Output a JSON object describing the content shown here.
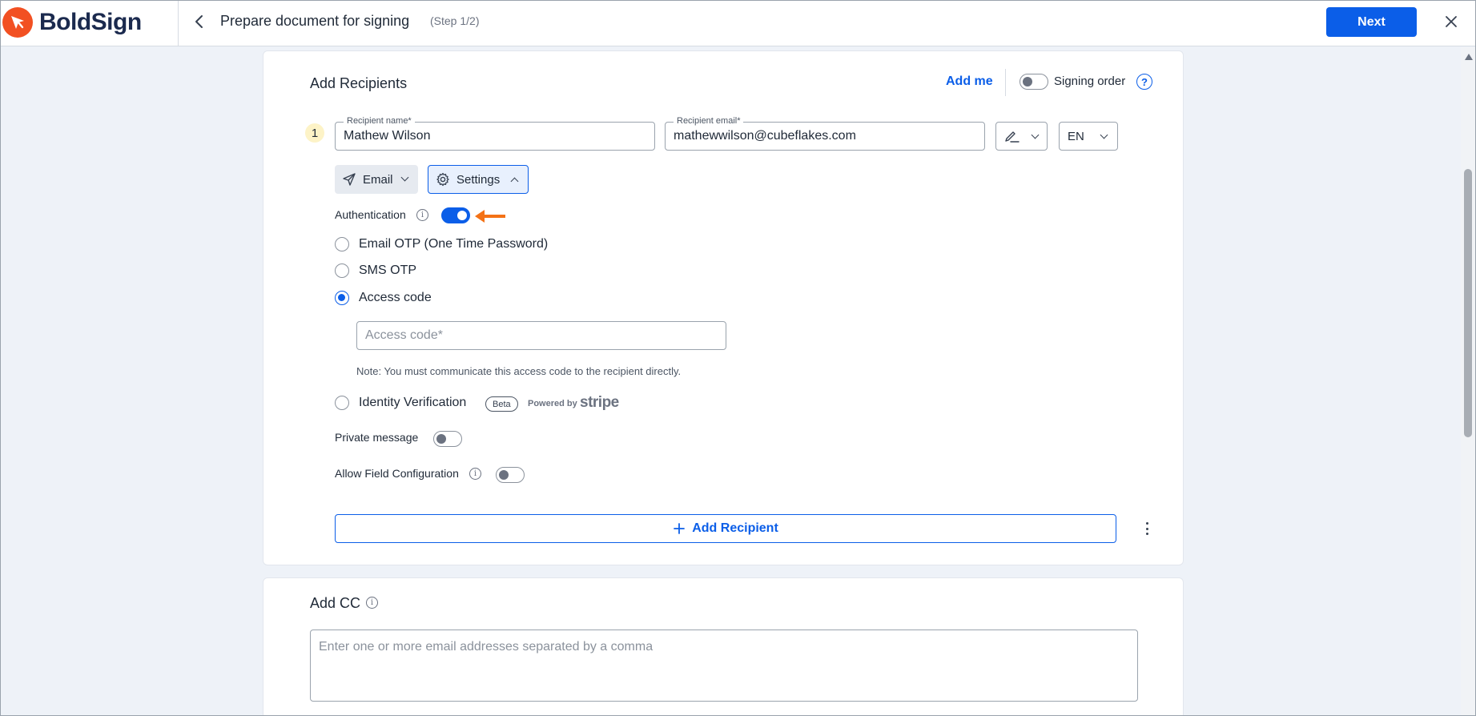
{
  "header": {
    "brand": "BoldSign",
    "title": "Prepare document for signing",
    "step": "(Step 1/2)",
    "next_label": "Next"
  },
  "recipients": {
    "title": "Add Recipients",
    "add_me": "Add me",
    "signing_order_label": "Signing order",
    "signing_order_on": false,
    "help": "?",
    "items": [
      {
        "index": "1",
        "name_label": "Recipient name*",
        "name_value": "Mathew Wilson",
        "email_label": "Recipient email*",
        "email_value": "mathewwilson@cubeflakes.com",
        "language": "EN",
        "delivery_label": "Email",
        "settings_label": "Settings"
      }
    ],
    "settings": {
      "authentication_label": "Authentication",
      "authentication_on": true,
      "options": [
        {
          "label": "Email OTP (One Time Password)",
          "checked": false
        },
        {
          "label": "SMS OTP",
          "checked": false
        },
        {
          "label": "Access code",
          "checked": true
        },
        {
          "label": "Identity Verification",
          "checked": false
        }
      ],
      "access_code_placeholder": "Access code*",
      "access_code_value": "",
      "note": "Note: You must communicate this access code to the recipient directly.",
      "beta_label": "Beta",
      "powered_by": "Powered by",
      "stripe": "stripe",
      "private_message_label": "Private message",
      "private_message_on": false,
      "allow_field_config_label": "Allow Field Configuration",
      "allow_field_config_on": false
    },
    "add_recipient_label": "Add Recipient"
  },
  "cc": {
    "title": "Add CC",
    "placeholder": "Enter one or more email addresses separated by a comma"
  },
  "colors": {
    "accent": "#0b5ee8",
    "brand": "#f25022",
    "arrow": "#f47216"
  }
}
